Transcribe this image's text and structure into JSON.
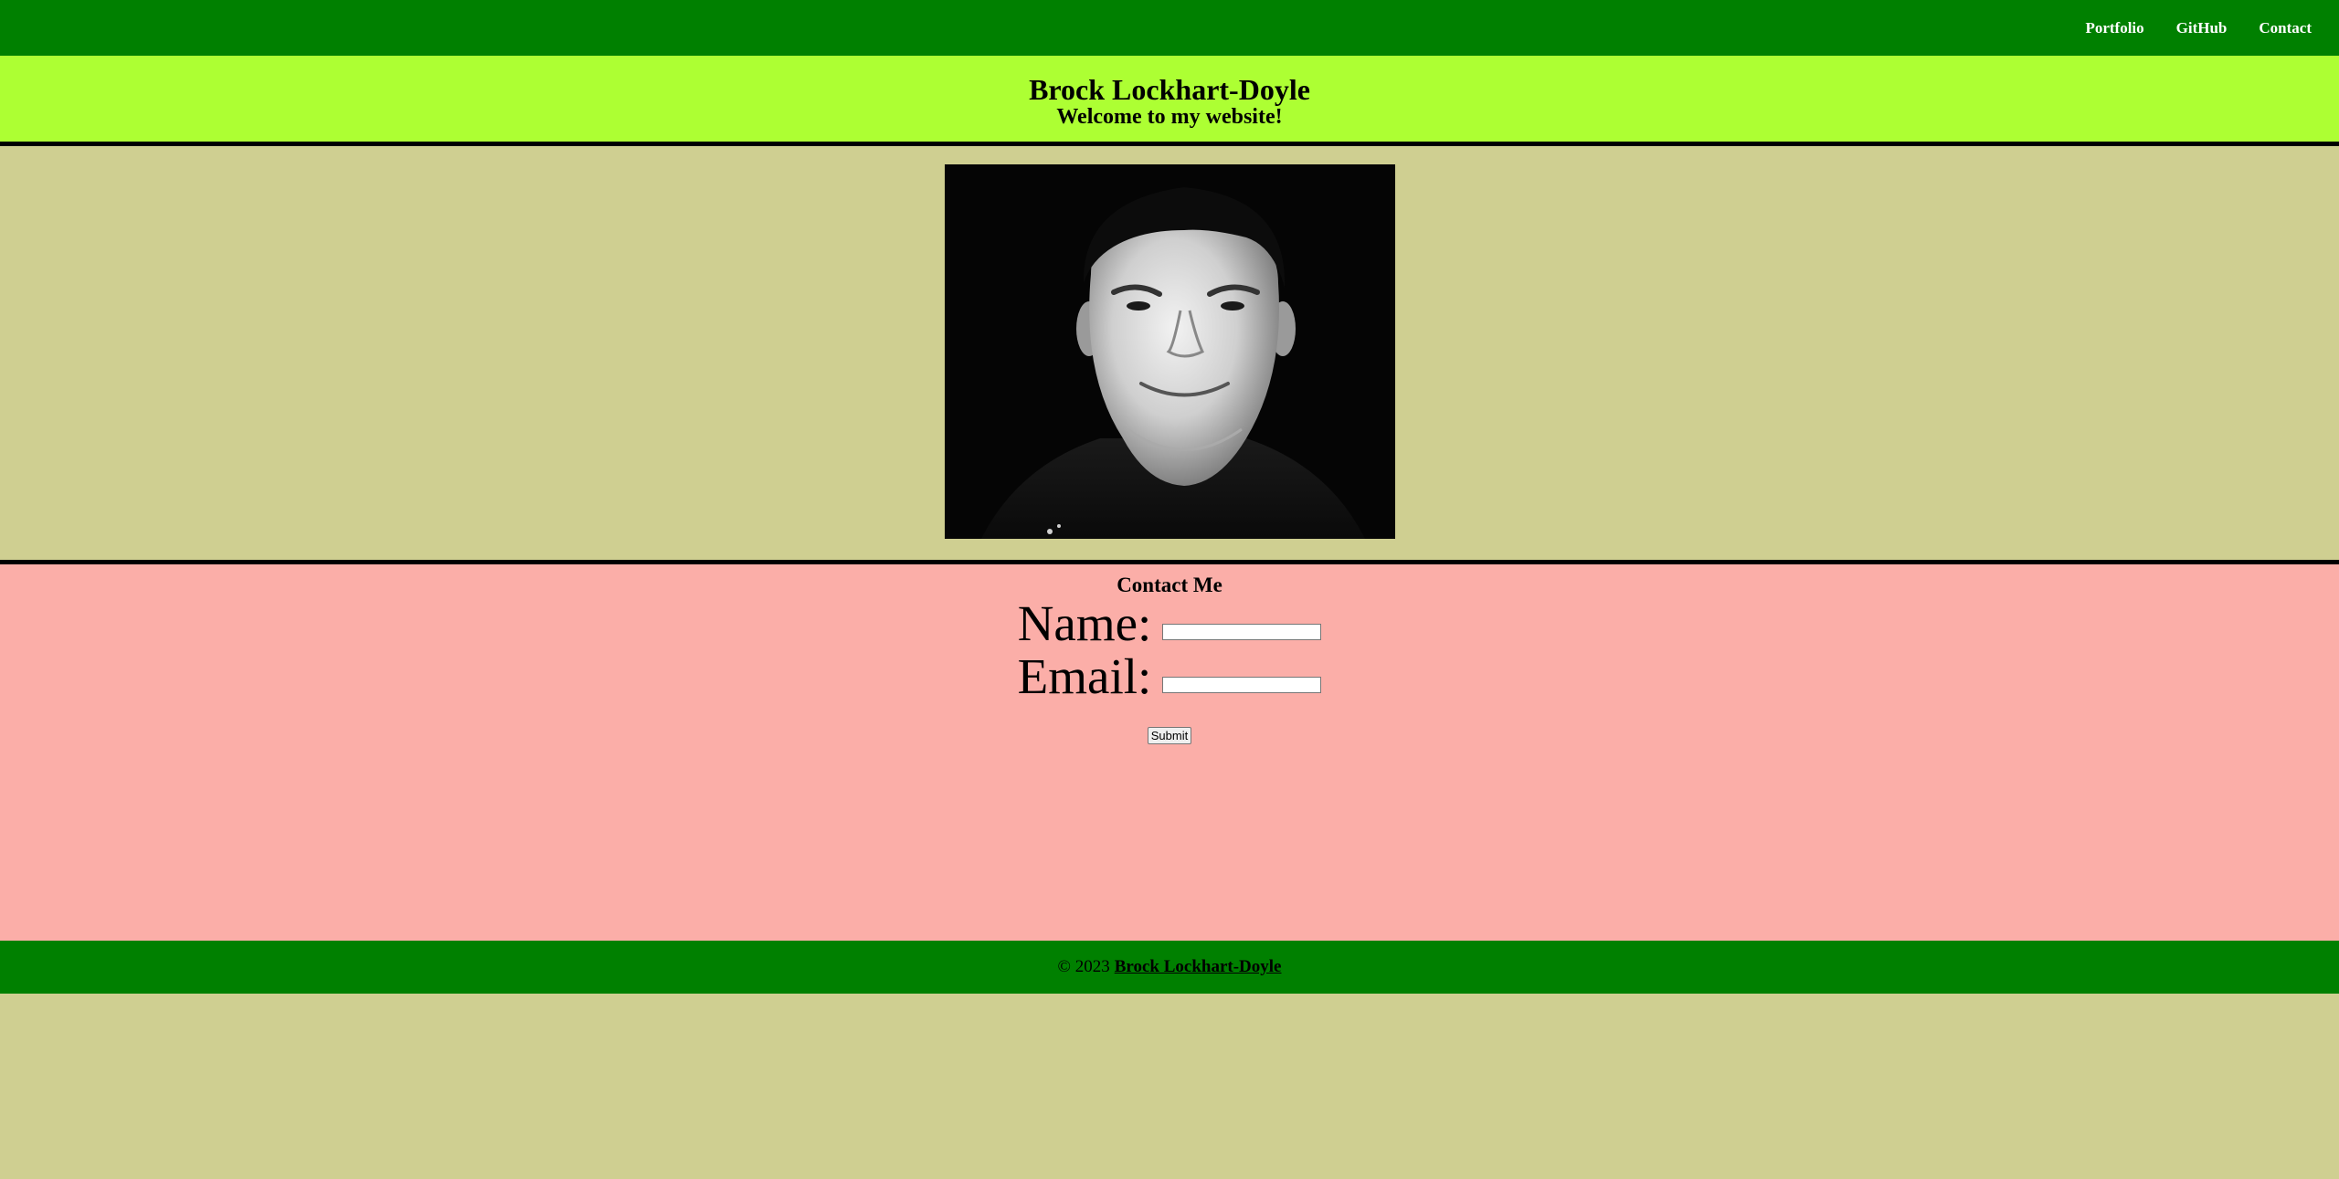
{
  "nav": {
    "links": [
      {
        "label": "Portfolio"
      },
      {
        "label": "GitHub"
      },
      {
        "label": "Contact"
      }
    ]
  },
  "header": {
    "title": "Brock Lockhart-Doyle",
    "subtitle": "Welcome to my website!"
  },
  "contact": {
    "heading": "Contact Me",
    "name_label": "Name:",
    "name_value": "",
    "email_label": "Email:",
    "email_value": "",
    "submit_label": "Submit"
  },
  "footer": {
    "copyright": "© 2023",
    "author_link": "Brock Lockhart-Doyle"
  },
  "colors": {
    "nav_bg": "#008000",
    "header_bg": "#adff33",
    "page_bg": "#cfcf91",
    "contact_bg": "#fbaea8",
    "footer_bg": "#008000"
  }
}
